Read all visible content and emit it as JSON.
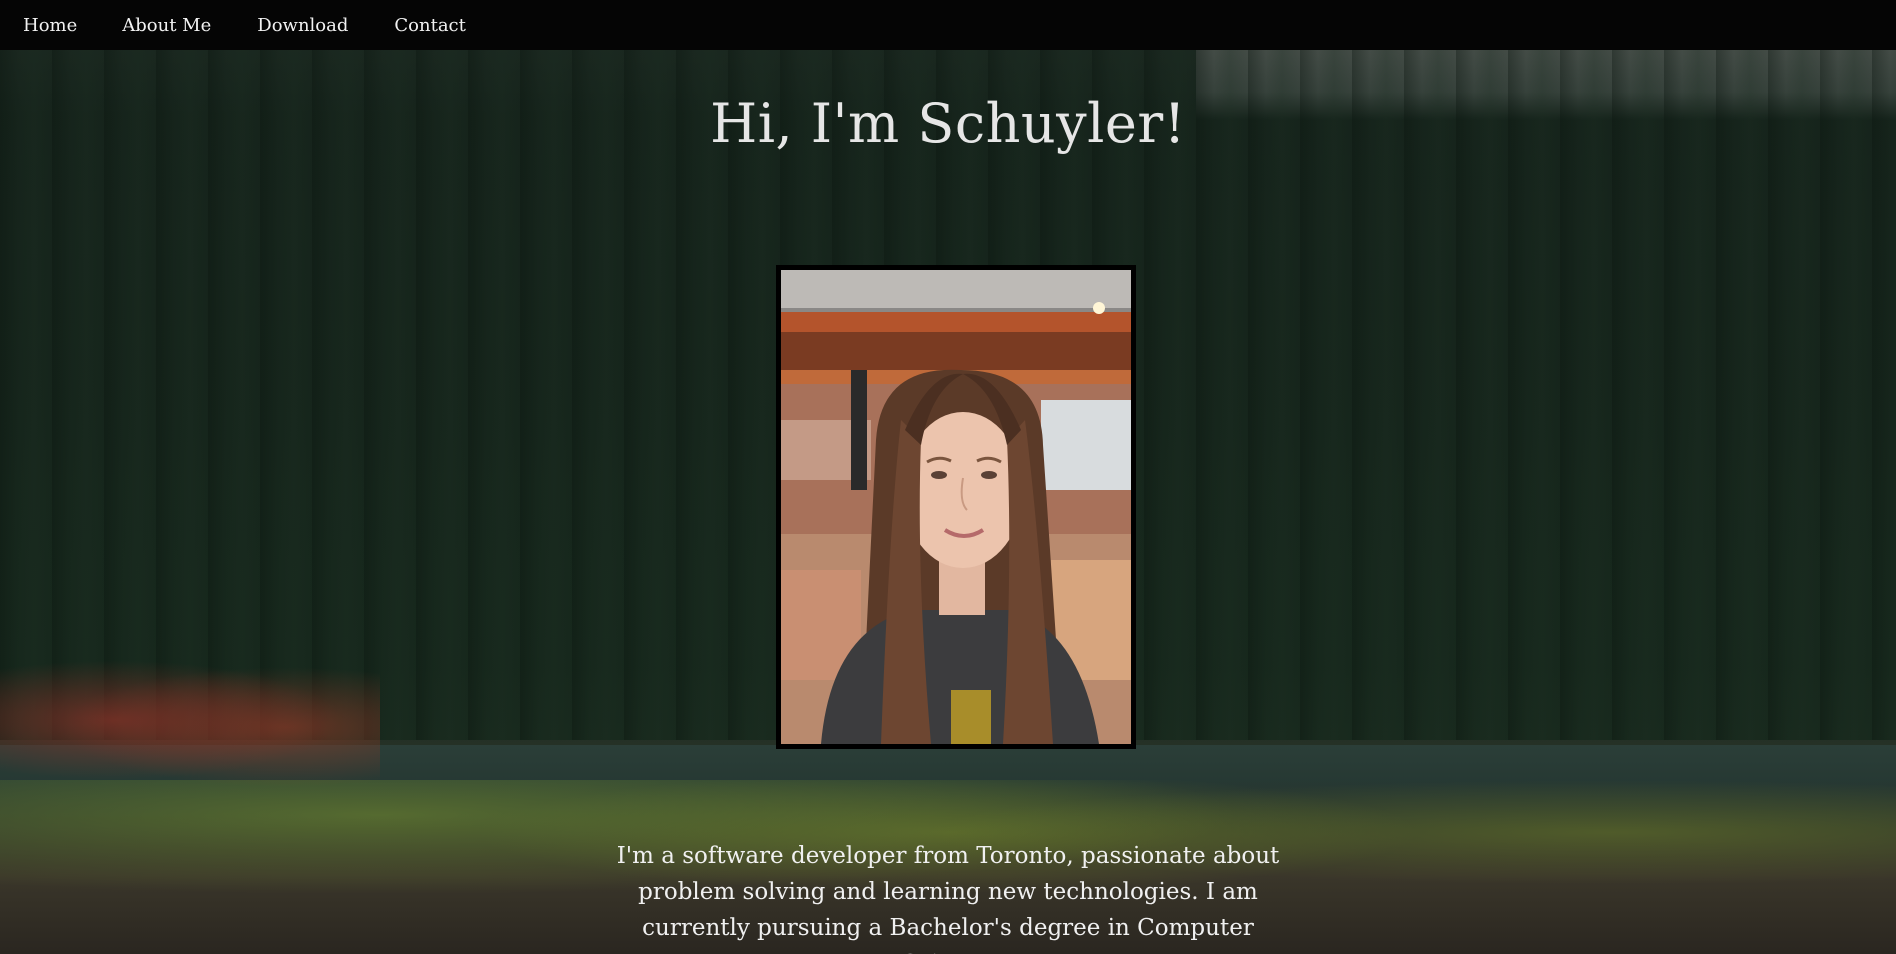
{
  "nav": {
    "items": [
      {
        "label": "Home"
      },
      {
        "label": "About Me"
      },
      {
        "label": "Download"
      },
      {
        "label": "Contact"
      }
    ]
  },
  "hero": {
    "title": "Hi, I'm Schuyler!",
    "bio": "I'm a software developer from Toronto, passionate about problem solving and learning new technologies. I am currently pursuing a Bachelor's degree in Computer Science"
  },
  "colors": {
    "navbar_bg": "#050505",
    "text": "#f0f0f0"
  }
}
